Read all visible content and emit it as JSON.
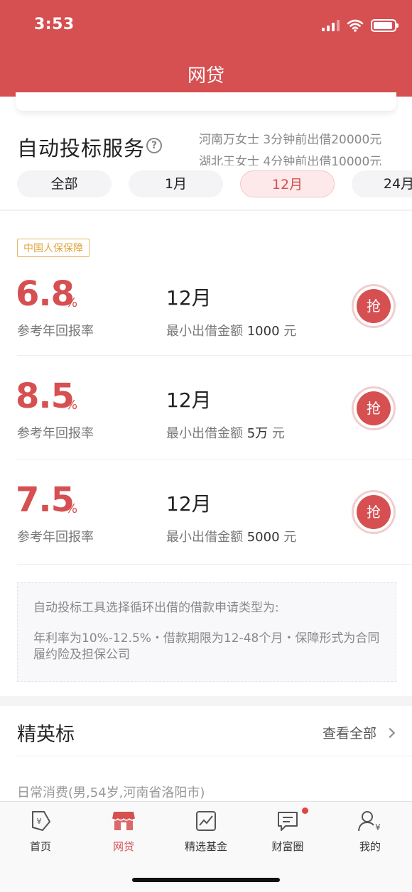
{
  "status": {
    "time": "3:53"
  },
  "nav": {
    "title": "网贷"
  },
  "service": {
    "title": "自动投标服务",
    "help_icon": "question-circle-icon",
    "ticker": [
      "河南万女士 3分钟前出借20000元",
      "湖北王女士 4分钟前出借10000元"
    ],
    "tabs": [
      "全部",
      "1月",
      "12月",
      "24月"
    ],
    "active_tab": "12月"
  },
  "badge": "中国人保保障",
  "products": [
    {
      "rate": "6.8",
      "rate_unit": "%",
      "rate_label": "参考年回报率",
      "term": "12月",
      "min_label": "最小出借金额",
      "min_value": "1000",
      "min_unit": "元",
      "grab": "抢"
    },
    {
      "rate": "8.5",
      "rate_unit": "%",
      "rate_label": "参考年回报率",
      "term": "12月",
      "min_label": "最小出借金额",
      "min_value": "5万",
      "min_unit": "元",
      "grab": "抢"
    },
    {
      "rate": "7.5",
      "rate_unit": "%",
      "rate_label": "参考年回报率",
      "term": "12月",
      "min_label": "最小出借金额",
      "min_value": "5000",
      "min_unit": "元",
      "grab": "抢"
    }
  ],
  "notice": {
    "line1": "自动投标工具选择循环出借的借款申请类型为:",
    "line2": "年利率为10%-12.5%・借款期限为12-48个月・保障形式为合同履约险及担保公司"
  },
  "elite": {
    "title": "精英标",
    "see_all": "查看全部",
    "preview": "日常消费(男,54岁,河南省洛阳市)"
  },
  "tabbar": [
    {
      "label": "首页",
      "icon": "home-tag-icon"
    },
    {
      "label": "网贷",
      "icon": "storefront-icon",
      "active": true
    },
    {
      "label": "精选基金",
      "icon": "chart-icon"
    },
    {
      "label": "财富圈",
      "icon": "chat-bubble-icon"
    },
    {
      "label": "我的",
      "icon": "user-yen-icon"
    }
  ],
  "colors": {
    "brand": "#d64f51",
    "badge": "#e2a43a"
  }
}
